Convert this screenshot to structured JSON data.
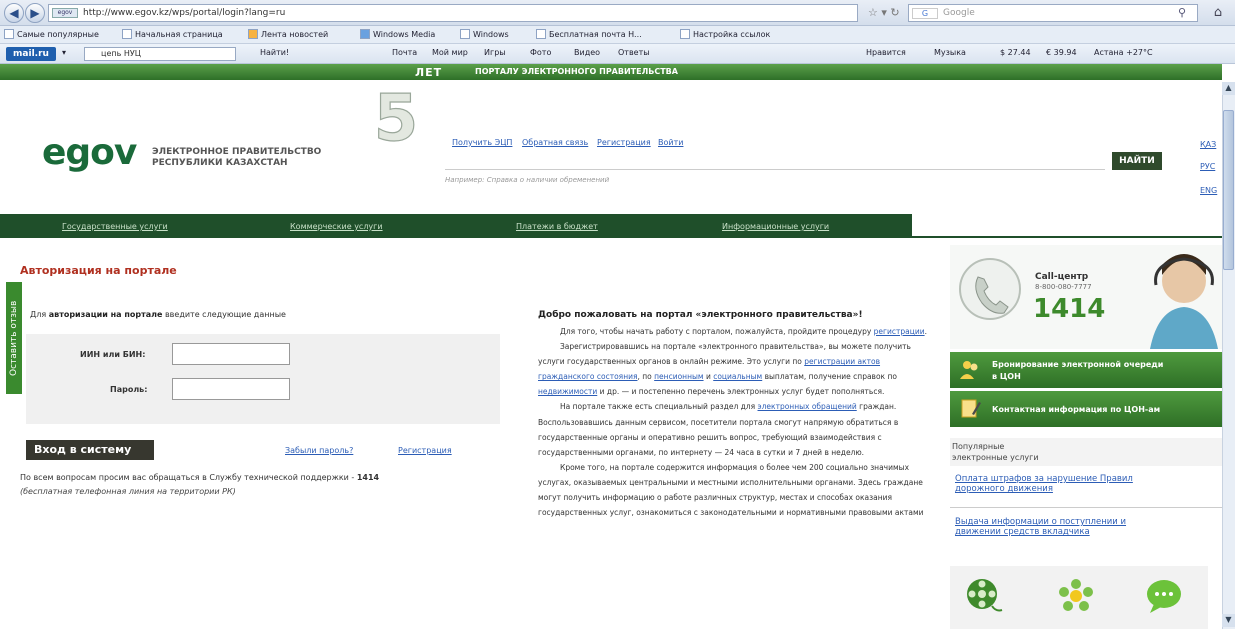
{
  "browser": {
    "url": "http://www.egov.kz/wps/portal/login?lang=ru",
    "search_placeholder": "Google",
    "bookmarks": [
      "Самые популярные",
      "Начальная страница",
      "Лента новостей",
      "Windows Media",
      "Windows",
      "Бесплатная почта H...",
      "Настройка ссылок"
    ],
    "mailru": {
      "logo": "mail.ru",
      "search_value": "цепь НУЦ",
      "find": "Найти!",
      "items": [
        "Почта",
        "Мой мир",
        "Игры",
        "Фото",
        "Видео",
        "Ответы"
      ],
      "right_items": [
        "Нравится",
        "Музыка",
        "27.44",
        "39.94",
        "Астана +27°C"
      ]
    }
  },
  "site": {
    "anniversary_label": "ЛЕТ",
    "anniversary_number": "5",
    "anniversary_text": "ПОРТАЛУ ЭЛЕКТРОННОГО ПРАВИТЕЛЬСТВА",
    "logo": "egov",
    "logo_sub1": "ЭЛЕКТРОННОЕ ПРАВИТЕЛЬСТВО",
    "logo_sub2": "РЕСПУБЛИКИ КАЗАХСТАН",
    "top_links": [
      "Получить ЭЦП",
      "Обратная связь",
      "Регистрация",
      "Войти"
    ],
    "search_hint": "Например: Справка о наличии обременений",
    "find_button": "НАЙТИ",
    "languages": [
      "ҚАЗ",
      "РУС",
      "ENG"
    ],
    "main_nav": [
      "Государственные услуги",
      "Коммерческие услуги",
      "Платежи в бюджет",
      "Информационные услуги"
    ],
    "feedback_tab": "Оставить отзыв"
  },
  "auth": {
    "title": "Авторизация на портале",
    "intro_prefix": "Для",
    "intro_bold": "авторизации на портале",
    "intro_suffix": "введите следующие данные",
    "iin_label": "ИИН или БИН:",
    "password_label": "Пароль:",
    "login_button": "Вход в систему",
    "forgot_link": "Забыли пароль?",
    "register_link": "Регистрация",
    "support_text": "По всем вопросам просим вас обращаться в Службу технической поддержки -",
    "support_number": "1414",
    "support_note": "(бесплатная телефонная линия на территории РК)"
  },
  "welcome": {
    "title": "Добро пожаловать на портал «электронного правительства»!",
    "p1_a": "Для того, чтобы начать работу с порталом, пожалуйста, пройдите процедуру",
    "p1_link": "регистрации",
    "p2_a": "Зарегистрировавшись на портале «электронного правительства», вы можете получить услуги государственных органов в онлайн режиме. Это услуги по",
    "p2_link1": "регистрации актов гражданского состояния",
    "p2_b": ", по",
    "p2_link2": "пенсионным",
    "p2_c": "и",
    "p2_link3": "социальным",
    "p2_d": "выплатам, получение справок по",
    "p2_link4": "недвижимости",
    "p2_e": "и др. — и постепенно перечень электронных услуг будет пополняться.",
    "p3_a": "На портале также есть специальный раздел для",
    "p3_link": "электронных обращений",
    "p3_b": "граждан. Воспользовавшись данным сервисом, посетители портала смогут напрямую обратиться в государственные органы и оперативно решить вопрос, требующий взаимодействия с государственными органами, по интернету — 24 часа в сутки и 7 дней в неделю.",
    "p4": "Кроме того, на портале содержится информация о более чем 200 социально значимых услугах, оказываемых центральными и местными исполнительными органами. Здесь граждане могут получить информацию о работе различных структур, местах и способах оказания государственных услуг, ознакомиться с законодательными и нормативными правовыми актами"
  },
  "sidebar": {
    "cc_title": "Call-центр",
    "cc_phone": "8-800-080-7777",
    "cc_big": "1414",
    "box1_line1": "Бронирование электронной очереди",
    "box1_line2": "в ЦОН",
    "box2": "Контактная информация по ЦОН-ам",
    "popular_line1": "Популярные",
    "popular_line2": "электронные услуги",
    "pop1_line1": "Оплата штрафов за нарушение Правил",
    "pop1_line2": "дорожного движения",
    "pop2_line1": "Выдача информации о поступлении и",
    "pop2_line2": "движении средств вкладчика"
  },
  "colors": {
    "brand_green": "#2e6f28",
    "nav_dark_green": "#1f4f2a",
    "title_red": "#b03020",
    "link_blue": "#2c5db6"
  }
}
